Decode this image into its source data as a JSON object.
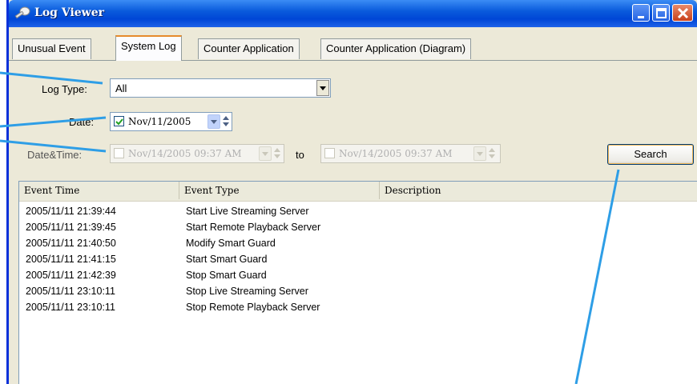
{
  "window": {
    "title": "Log Viewer"
  },
  "tabs": [
    {
      "label": "Unusual Event",
      "active": false
    },
    {
      "label": "System Log",
      "active": true
    },
    {
      "label": "Counter Application",
      "active": false
    },
    {
      "label": "Counter Application (Diagram)",
      "active": false
    }
  ],
  "filters": {
    "log_type_label": "Log Type:",
    "log_type_value": "All",
    "date_label": "Date:",
    "date_value": "Nov/11/2005",
    "date_checked": true,
    "datetime_label": "Date&Time:",
    "datetime_from": "Nov/14/2005 09:37 AM",
    "datetime_to_label": "to",
    "datetime_to": "Nov/14/2005 09:37 AM",
    "datetime_enabled": false,
    "search_label": "Search"
  },
  "table": {
    "columns": [
      "Event Time",
      "Event Type",
      "Description"
    ],
    "rows": [
      {
        "time": "2005/11/11 21:39:44",
        "type": "Start Live Streaming Server",
        "description": ""
      },
      {
        "time": "2005/11/11 21:39:45",
        "type": "Start Remote Playback Server",
        "description": ""
      },
      {
        "time": "2005/11/11 21:40:50",
        "type": "Modify Smart Guard",
        "description": ""
      },
      {
        "time": "2005/11/11 21:41:15",
        "type": "Start Smart Guard",
        "description": ""
      },
      {
        "time": "2005/11/11 21:42:39",
        "type": "Stop Smart Guard",
        "description": ""
      },
      {
        "time": "2005/11/11 23:10:11",
        "type": "Stop Live Streaming Server",
        "description": ""
      },
      {
        "time": "2005/11/11 23:10:11",
        "type": "Stop Remote Playback Server",
        "description": ""
      }
    ]
  },
  "colors": {
    "titlebar": "#0a5bdc",
    "window_bg": "#ece9d8",
    "callout": "#2e9ee6",
    "active_tab_accent": "#e68b2c"
  },
  "icons": {
    "title": "key-icon",
    "minimize": "minimize-icon",
    "maximize": "maximize-icon",
    "close": "close-icon"
  }
}
